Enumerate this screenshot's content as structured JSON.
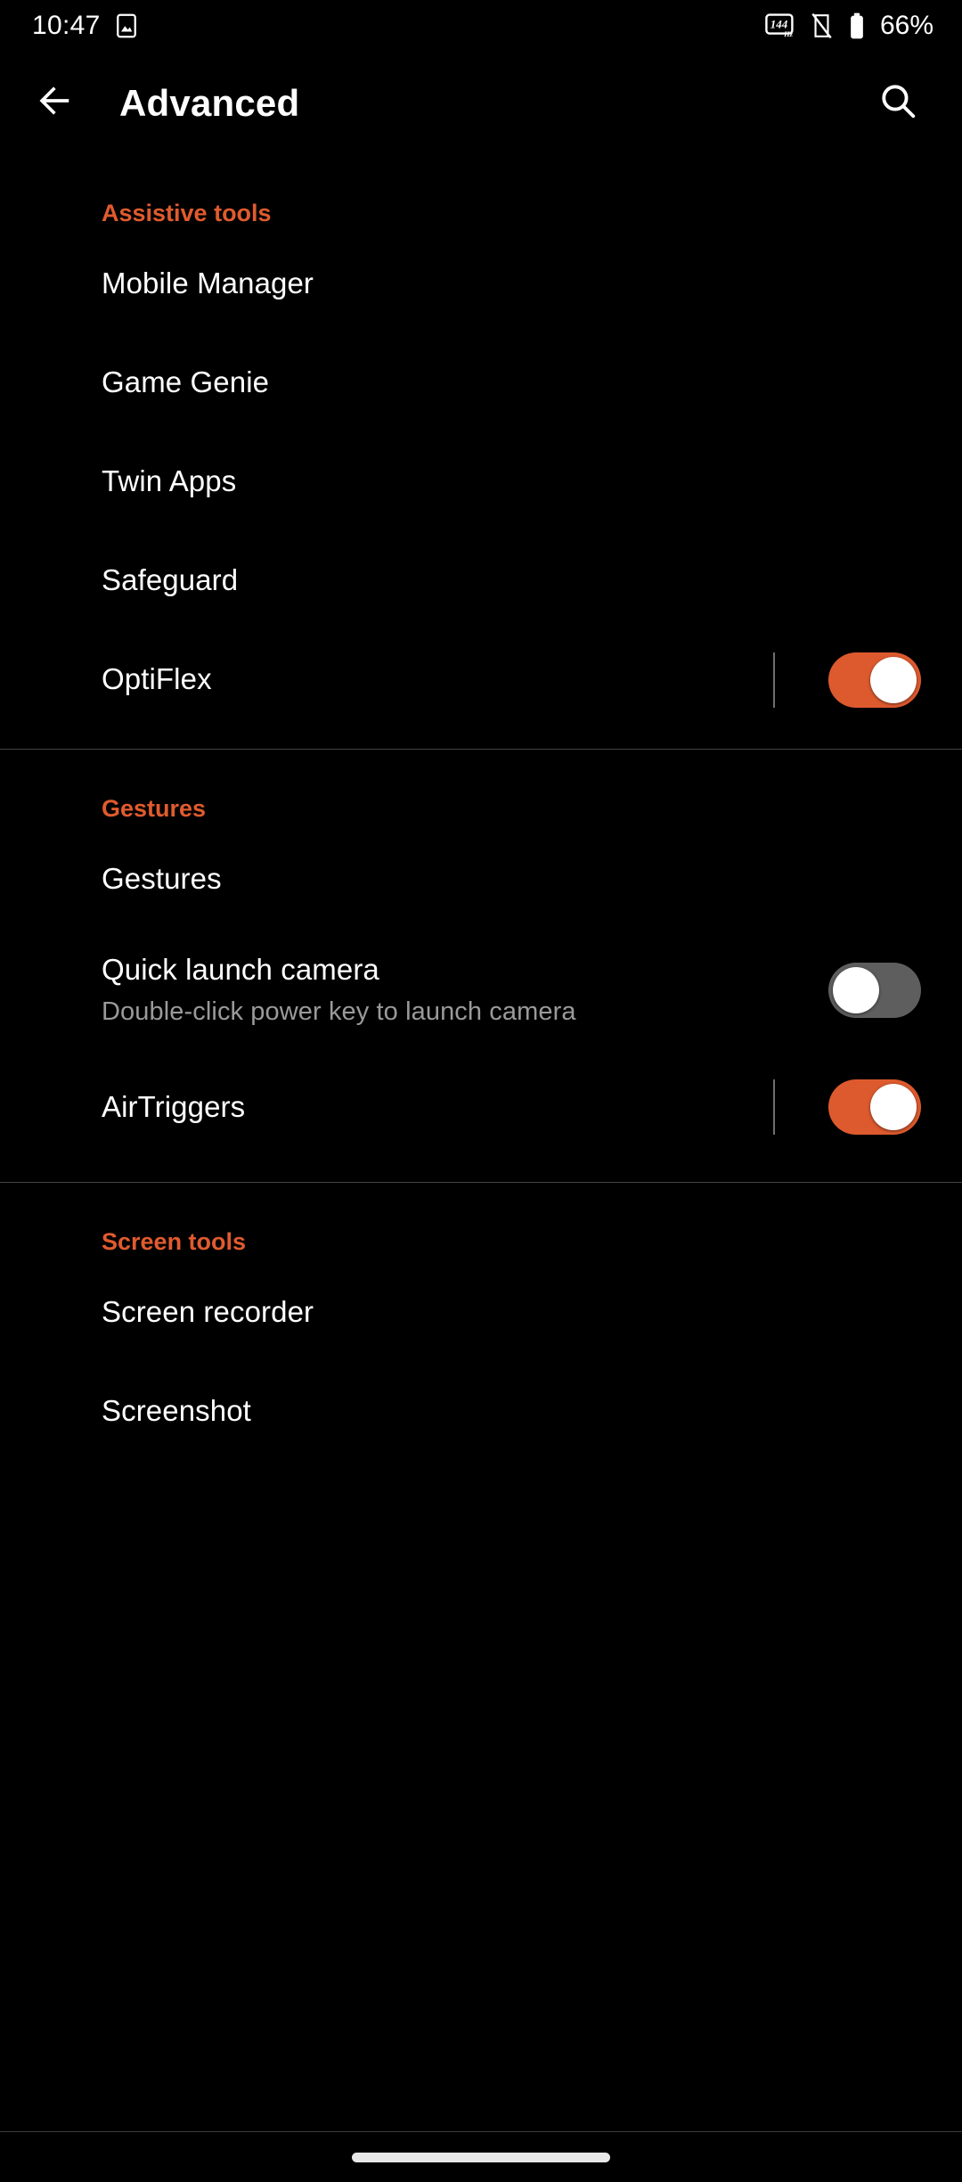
{
  "status_bar": {
    "clock": "10:47",
    "left_icons": [
      {
        "name": "screenshot-image-icon",
        "label": "image"
      }
    ],
    "right_icons": [
      {
        "name": "refresh-rate-icon",
        "label": "144",
        "sub_label": "Hz"
      },
      {
        "name": "silent-mode-icon",
        "label": "vibrate-off"
      },
      {
        "name": "battery-icon",
        "label": "battery"
      }
    ],
    "battery_percent": "66%"
  },
  "app_bar": {
    "back_label": "back-arrow",
    "title": "Advanced",
    "search_label": "search"
  },
  "colors": {
    "accent": "#e05b2e",
    "switch_on_track": "#dd5a2e",
    "switch_off_track": "#5e5e5e",
    "background": "#000000",
    "primary_text": "#ffffff",
    "secondary_text": "#9a9a9a",
    "divider": "#444444"
  },
  "sections": [
    {
      "header": "Assistive tools",
      "rows": [
        {
          "title": "Mobile Manager",
          "subtitle": "",
          "widget": "none",
          "switch_state": ""
        },
        {
          "title": "Game Genie",
          "subtitle": "",
          "widget": "none",
          "switch_state": ""
        },
        {
          "title": "Twin Apps",
          "subtitle": "",
          "widget": "none",
          "switch_state": ""
        },
        {
          "title": "Safeguard",
          "subtitle": "",
          "widget": "none",
          "switch_state": ""
        },
        {
          "title": "OptiFlex",
          "subtitle": "",
          "widget": "switch-with-divider",
          "switch_state": "on"
        }
      ]
    },
    {
      "header": "Gestures",
      "rows": [
        {
          "title": "Gestures",
          "subtitle": "",
          "widget": "none",
          "switch_state": ""
        },
        {
          "title": "Quick launch camera",
          "subtitle": "Double-click power key to launch camera",
          "widget": "switch",
          "switch_state": "off"
        },
        {
          "title": "AirTriggers",
          "subtitle": "",
          "widget": "switch-with-divider",
          "switch_state": "on"
        }
      ]
    },
    {
      "header": "Screen tools",
      "rows": [
        {
          "title": "Screen recorder",
          "subtitle": "",
          "widget": "none",
          "switch_state": ""
        },
        {
          "title": "Screenshot",
          "subtitle": "",
          "widget": "none",
          "switch_state": ""
        }
      ]
    }
  ],
  "nav_bar": {
    "gesture_pill": "home-gesture-pill"
  }
}
